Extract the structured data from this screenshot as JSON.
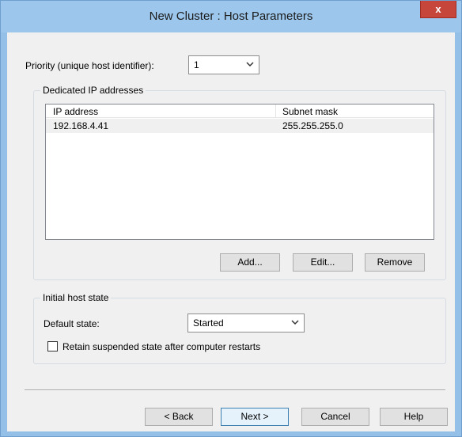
{
  "window": {
    "title": "New Cluster :  Host Parameters",
    "close_glyph": "x"
  },
  "priority": {
    "label": "Priority (unique host identifier):",
    "value": "1"
  },
  "dedicated_ip": {
    "group_title": "Dedicated IP addresses",
    "columns": [
      "IP address",
      "Subnet mask"
    ],
    "rows": [
      {
        "ip": "192.168.4.41",
        "mask": "255.255.255.0"
      }
    ],
    "buttons": {
      "add": "Add...",
      "edit": "Edit...",
      "remove": "Remove"
    }
  },
  "host_state": {
    "group_title": "Initial host state",
    "default_label": "Default state:",
    "default_value": "Started",
    "retain_label": "Retain suspended state after computer restarts",
    "retain_checked": false
  },
  "footer": {
    "back": "< Back",
    "next": "Next >",
    "cancel": "Cancel",
    "help": "Help"
  }
}
